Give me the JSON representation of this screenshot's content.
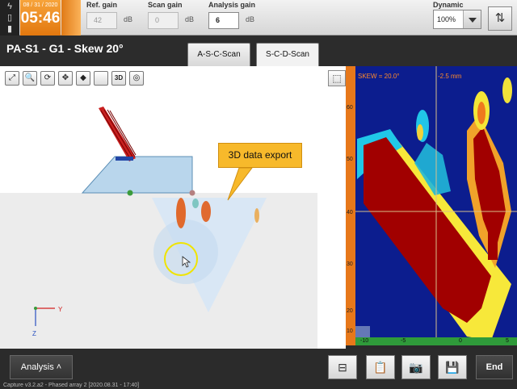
{
  "header": {
    "date": "08 / 31 / 2020",
    "time": "05:46",
    "ref_gain": {
      "label": "Ref. gain",
      "value": "42",
      "unit": "dB"
    },
    "scan_gain": {
      "label": "Scan gain",
      "value": "0",
      "unit": "dB"
    },
    "analysis_gain": {
      "label": "Analysis gain",
      "value": "6",
      "unit": "dB"
    },
    "dynamic": {
      "label": "Dynamic",
      "value": "100%"
    }
  },
  "titlebar": {
    "title": "PA-S1 - G1 - Skew 20°",
    "tabs": [
      {
        "label": "A-S-C-Scan"
      },
      {
        "label": "S-C-D-Scan"
      }
    ]
  },
  "view3d": {
    "toolbar": [
      {
        "name": "fit-icon",
        "glyph": "⤢"
      },
      {
        "name": "zoom-icon",
        "glyph": "🔍"
      },
      {
        "name": "rotate-icon",
        "glyph": "⟳"
      },
      {
        "name": "pan-icon",
        "glyph": "✥"
      },
      {
        "name": "probe-icon",
        "glyph": "◆"
      },
      {
        "name": "blank-icon",
        "glyph": ""
      },
      {
        "name": "3d-icon",
        "glyph": "3D"
      },
      {
        "name": "palette-icon",
        "glyph": "◎"
      }
    ],
    "callout": "3D data export",
    "axis_y": "Y",
    "axis_z": "Z"
  },
  "sscan": {
    "skew_label": "SKEW = 20.0°",
    "depth_label": "-2.5 mm",
    "y_ticks": [
      "10",
      "20",
      "30",
      "40",
      "50",
      "60"
    ],
    "x_ticks": [
      "-10",
      "-5",
      "0",
      "5"
    ]
  },
  "footer": {
    "analysis_label": "Analysis ˄",
    "end_label": "End",
    "status_text": "Capture v3.2.a2 - Phased array 2 [2020.08.31 - 17:40]"
  }
}
